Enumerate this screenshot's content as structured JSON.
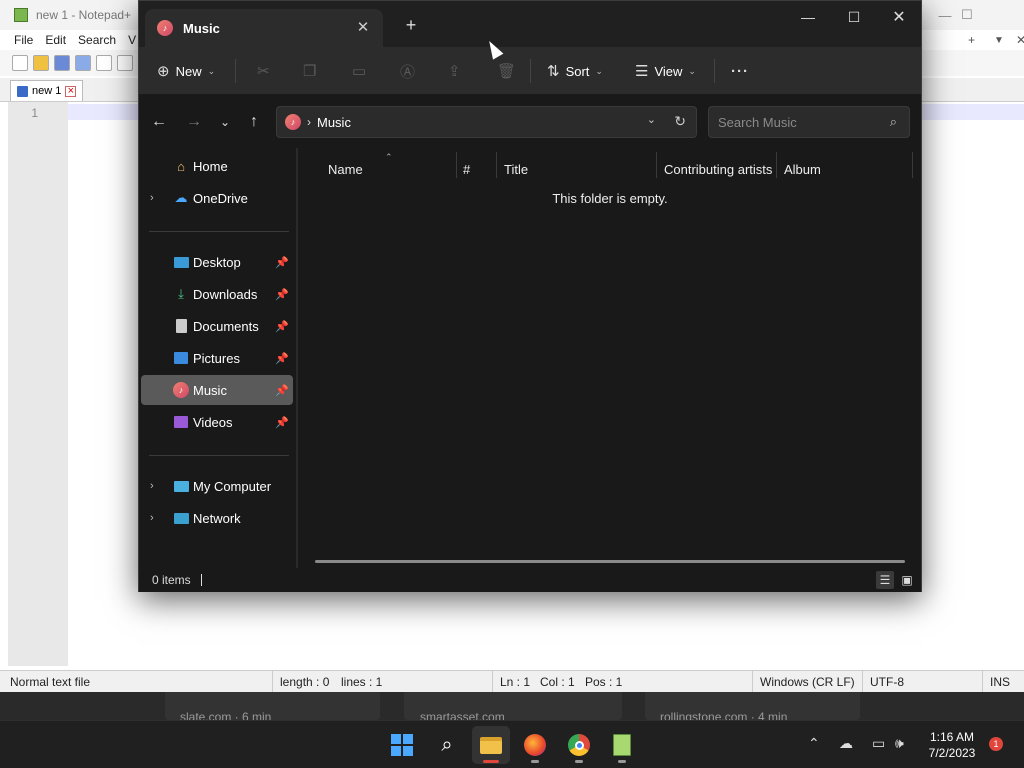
{
  "notepad": {
    "title": "new 1 - Notepad+",
    "menu": [
      "File",
      "Edit",
      "Search",
      "V"
    ],
    "tab": "new 1",
    "line_number": "1",
    "status": {
      "file_type": "Normal text file",
      "length": "length : 0",
      "lines": "lines : 1",
      "ln": "Ln : 1",
      "col": "Col : 1",
      "pos": "Pos : 1",
      "eol": "Windows (CR LF)",
      "encoding": "UTF-8",
      "mode": "INS"
    }
  },
  "browser_history": [
    "slate.com · 6 min",
    "smartasset.com",
    "rollingstone.com · 4 min"
  ],
  "explorer": {
    "tab_title": "Music",
    "commands": {
      "new": "New",
      "sort": "Sort",
      "view": "View"
    },
    "address": {
      "location": "Music",
      "search_placeholder": "Search Music"
    },
    "nav": {
      "home": "Home",
      "onedrive": "OneDrive",
      "desktop": "Desktop",
      "downloads": "Downloads",
      "documents": "Documents",
      "pictures": "Pictures",
      "music": "Music",
      "videos": "Videos",
      "my_computer": "My Computer",
      "network": "Network"
    },
    "columns": {
      "name": "Name",
      "number": "#",
      "title": "Title",
      "artists": "Contributing artists",
      "album": "Album"
    },
    "empty_message": "This folder is empty.",
    "status_items": "0 items"
  },
  "taskbar": {
    "time": "1:16 AM",
    "date": "7/2/2023",
    "notification_count": "1"
  },
  "colors": {
    "explorer_bg": "#191919",
    "accent": "#4aa8ff",
    "selected_nav": "#5a5a5a",
    "notification": "#e0463c"
  }
}
